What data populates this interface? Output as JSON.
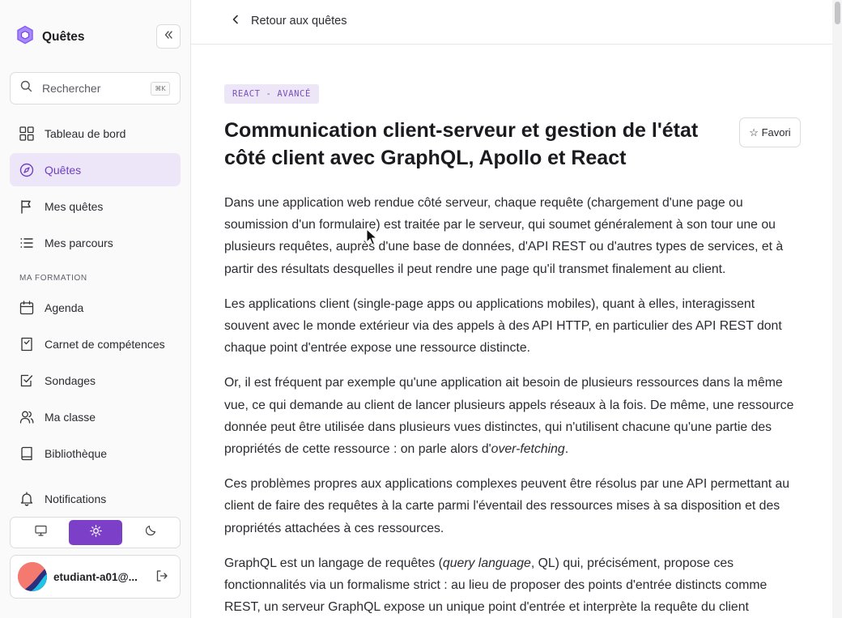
{
  "sidebar": {
    "brand_title": "Quêtes",
    "search": {
      "placeholder": "Rechercher",
      "shortcut": "⌘K"
    },
    "nav_items": [
      {
        "label": "Tableau de bord",
        "icon": "dashboard-icon"
      },
      {
        "label": "Quêtes",
        "icon": "compass-icon",
        "active": true
      },
      {
        "label": "Mes quêtes",
        "icon": "flag-icon"
      },
      {
        "label": "Mes parcours",
        "icon": "list-icon"
      }
    ],
    "section_label": "MA FORMATION",
    "formation_items": [
      {
        "label": "Agenda",
        "icon": "calendar-icon"
      },
      {
        "label": "Carnet de compétences",
        "icon": "skills-book-icon"
      },
      {
        "label": "Sondages",
        "icon": "survey-check-icon"
      },
      {
        "label": "Ma classe",
        "icon": "users-icon"
      },
      {
        "label": "Bibliothèque",
        "icon": "book-icon"
      },
      {
        "label": "Notifications",
        "icon": "bell-icon"
      }
    ],
    "theme": {
      "options": [
        "monitor-icon",
        "sun-icon",
        "moon-icon"
      ],
      "selected": "sun-icon"
    },
    "user": {
      "name": "etudiant-a01@..."
    }
  },
  "topbar": {
    "back_label": "Retour aux quêtes"
  },
  "article": {
    "tag": "REACT - AVANCÉ",
    "title": "Communication client-serveur et gestion de l'état côté client avec GraphQL, Apollo et React",
    "favorite_label": "☆ Favori",
    "paragraphs": {
      "p1": "Dans une application web rendue côté serveur, chaque requête (chargement d'une page ou soumission d'un formulaire) est traitée par le serveur, qui soumet généralement à son tour une ou plusieurs requêtes, auprès d'une base de données, d'API REST ou d'autres types de services, et à partir des résultats desquelles il peut rendre une page qu'il transmet finalement au client.",
      "p2": "Les applications client (single-page apps ou applications mobiles), quant à elles, interagissent souvent avec le monde extérieur via des appels à des API HTTP, en particulier des API REST dont chaque point d'entrée expose une ressource distincte.",
      "p3_a": "Or, il est fréquent par exemple qu'une application ait besoin de plusieurs ressources dans la même vue, ce qui demande au client de lancer plusieurs appels réseaux à la fois. De même, une ressource donnée peut être utilisée dans plusieurs vues distinctes, qui n'utilisent chacune qu'une partie des propriétés de cette ressource : on parle alors d'",
      "p3_em": "over-fetching",
      "p3_b": ".",
      "p4": "Ces problèmes propres aux applications complexes peuvent être résolus par une API permettant au client de faire des requêtes à la carte parmi l'éventail des ressources mises à sa disposition et des propriétés attachées à ces ressources.",
      "p5_a": "GraphQL est un langage de requêtes (",
      "p5_em": "query language",
      "p5_b": ", QL) qui, précisément, propose ces fonctionnalités via un formalisme strict : au lieu de proposer des points d'entrée distincts comme REST, un serveur GraphQL expose un unique point d'entrée et interprète la requête du client"
    }
  },
  "colors": {
    "accent": "#7c3fc7",
    "accent_bg": "#ede6f8",
    "brand_icon": "#8b5cf6"
  }
}
